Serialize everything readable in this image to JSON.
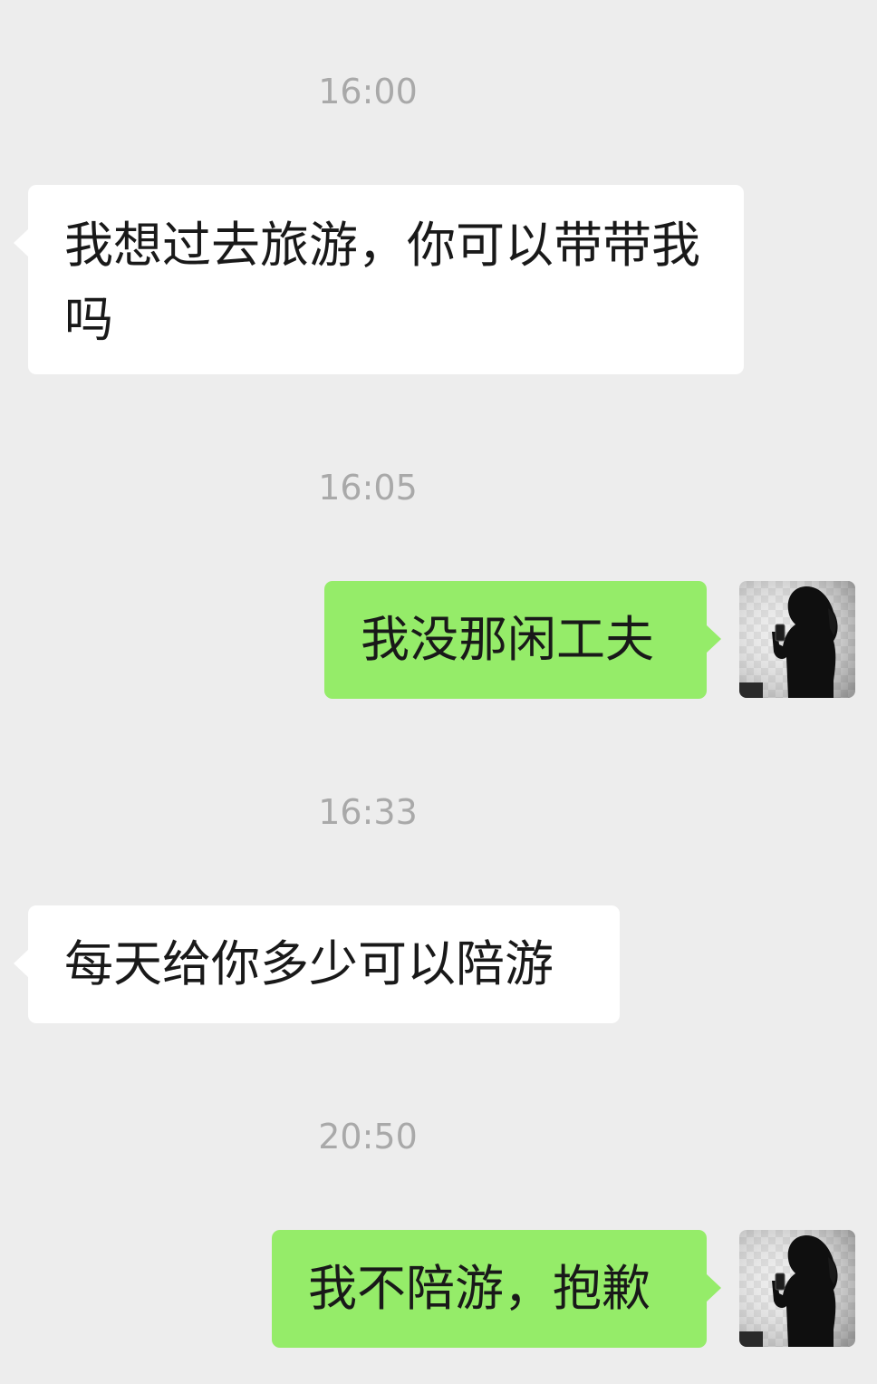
{
  "chat": {
    "messages": [
      {
        "time": "16:00",
        "side": "in",
        "text": "我想过去旅游，你可以带带我吗"
      },
      {
        "time": "16:05",
        "side": "out",
        "text": "我没那闲工夫"
      },
      {
        "time": "16:33",
        "side": "in",
        "text": "每天给你多少可以陪游"
      },
      {
        "time": "20:50",
        "side": "out",
        "text": "我不陪游，抱歉"
      }
    ]
  },
  "colors": {
    "background": "#ededed",
    "incoming_bubble": "#ffffff",
    "outgoing_bubble": "#95ec69",
    "timestamp_text": "#a9a9a9",
    "message_text": "#191919"
  },
  "icons": {
    "avatar": "silhouette-avatar"
  }
}
